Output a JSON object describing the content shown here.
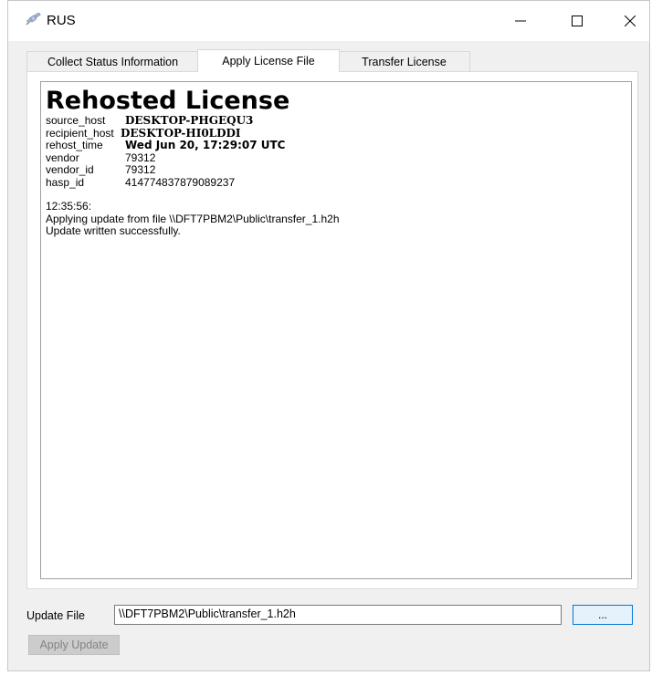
{
  "window": {
    "title": "RUS",
    "controls": {
      "minimize": "—",
      "maximize": "☐",
      "close": "✕"
    }
  },
  "tabs": [
    {
      "label": "Collect Status Information",
      "active": false
    },
    {
      "label": "Apply License File",
      "active": true
    },
    {
      "label": "Transfer License",
      "active": false
    }
  ],
  "report": {
    "heading": "Rehosted License",
    "fields": [
      {
        "key": "source_host",
        "value": "DESKTOP-PHGEQU3"
      },
      {
        "key": "recipient_host",
        "value": "DESKTOP-HI0LDDI"
      },
      {
        "key": "rehost_time",
        "value": "Wed Jun 20, 17:29:07 UTC"
      },
      {
        "key": "vendor",
        "value": "79312"
      },
      {
        "key": "vendor_id",
        "value": "79312"
      },
      {
        "key": "hasp_id",
        "value": "414774837879089237"
      }
    ],
    "log": [
      "12:35:56:",
      "Applying update from file \\\\DFT7PBM2\\Public\\transfer_1.h2h",
      "Update written successfully."
    ]
  },
  "update_file": {
    "label": "Update File",
    "value": "\\\\DFT7PBM2\\Public\\transfer_1.h2h",
    "browse_label": "..."
  },
  "apply_button": {
    "label": "Apply Update",
    "enabled": false
  },
  "icons": {
    "app": "satellite-icon"
  },
  "colors": {
    "accent": "#0078d7",
    "disabled_button": "#cccccc",
    "disabled_text": "#838383"
  }
}
